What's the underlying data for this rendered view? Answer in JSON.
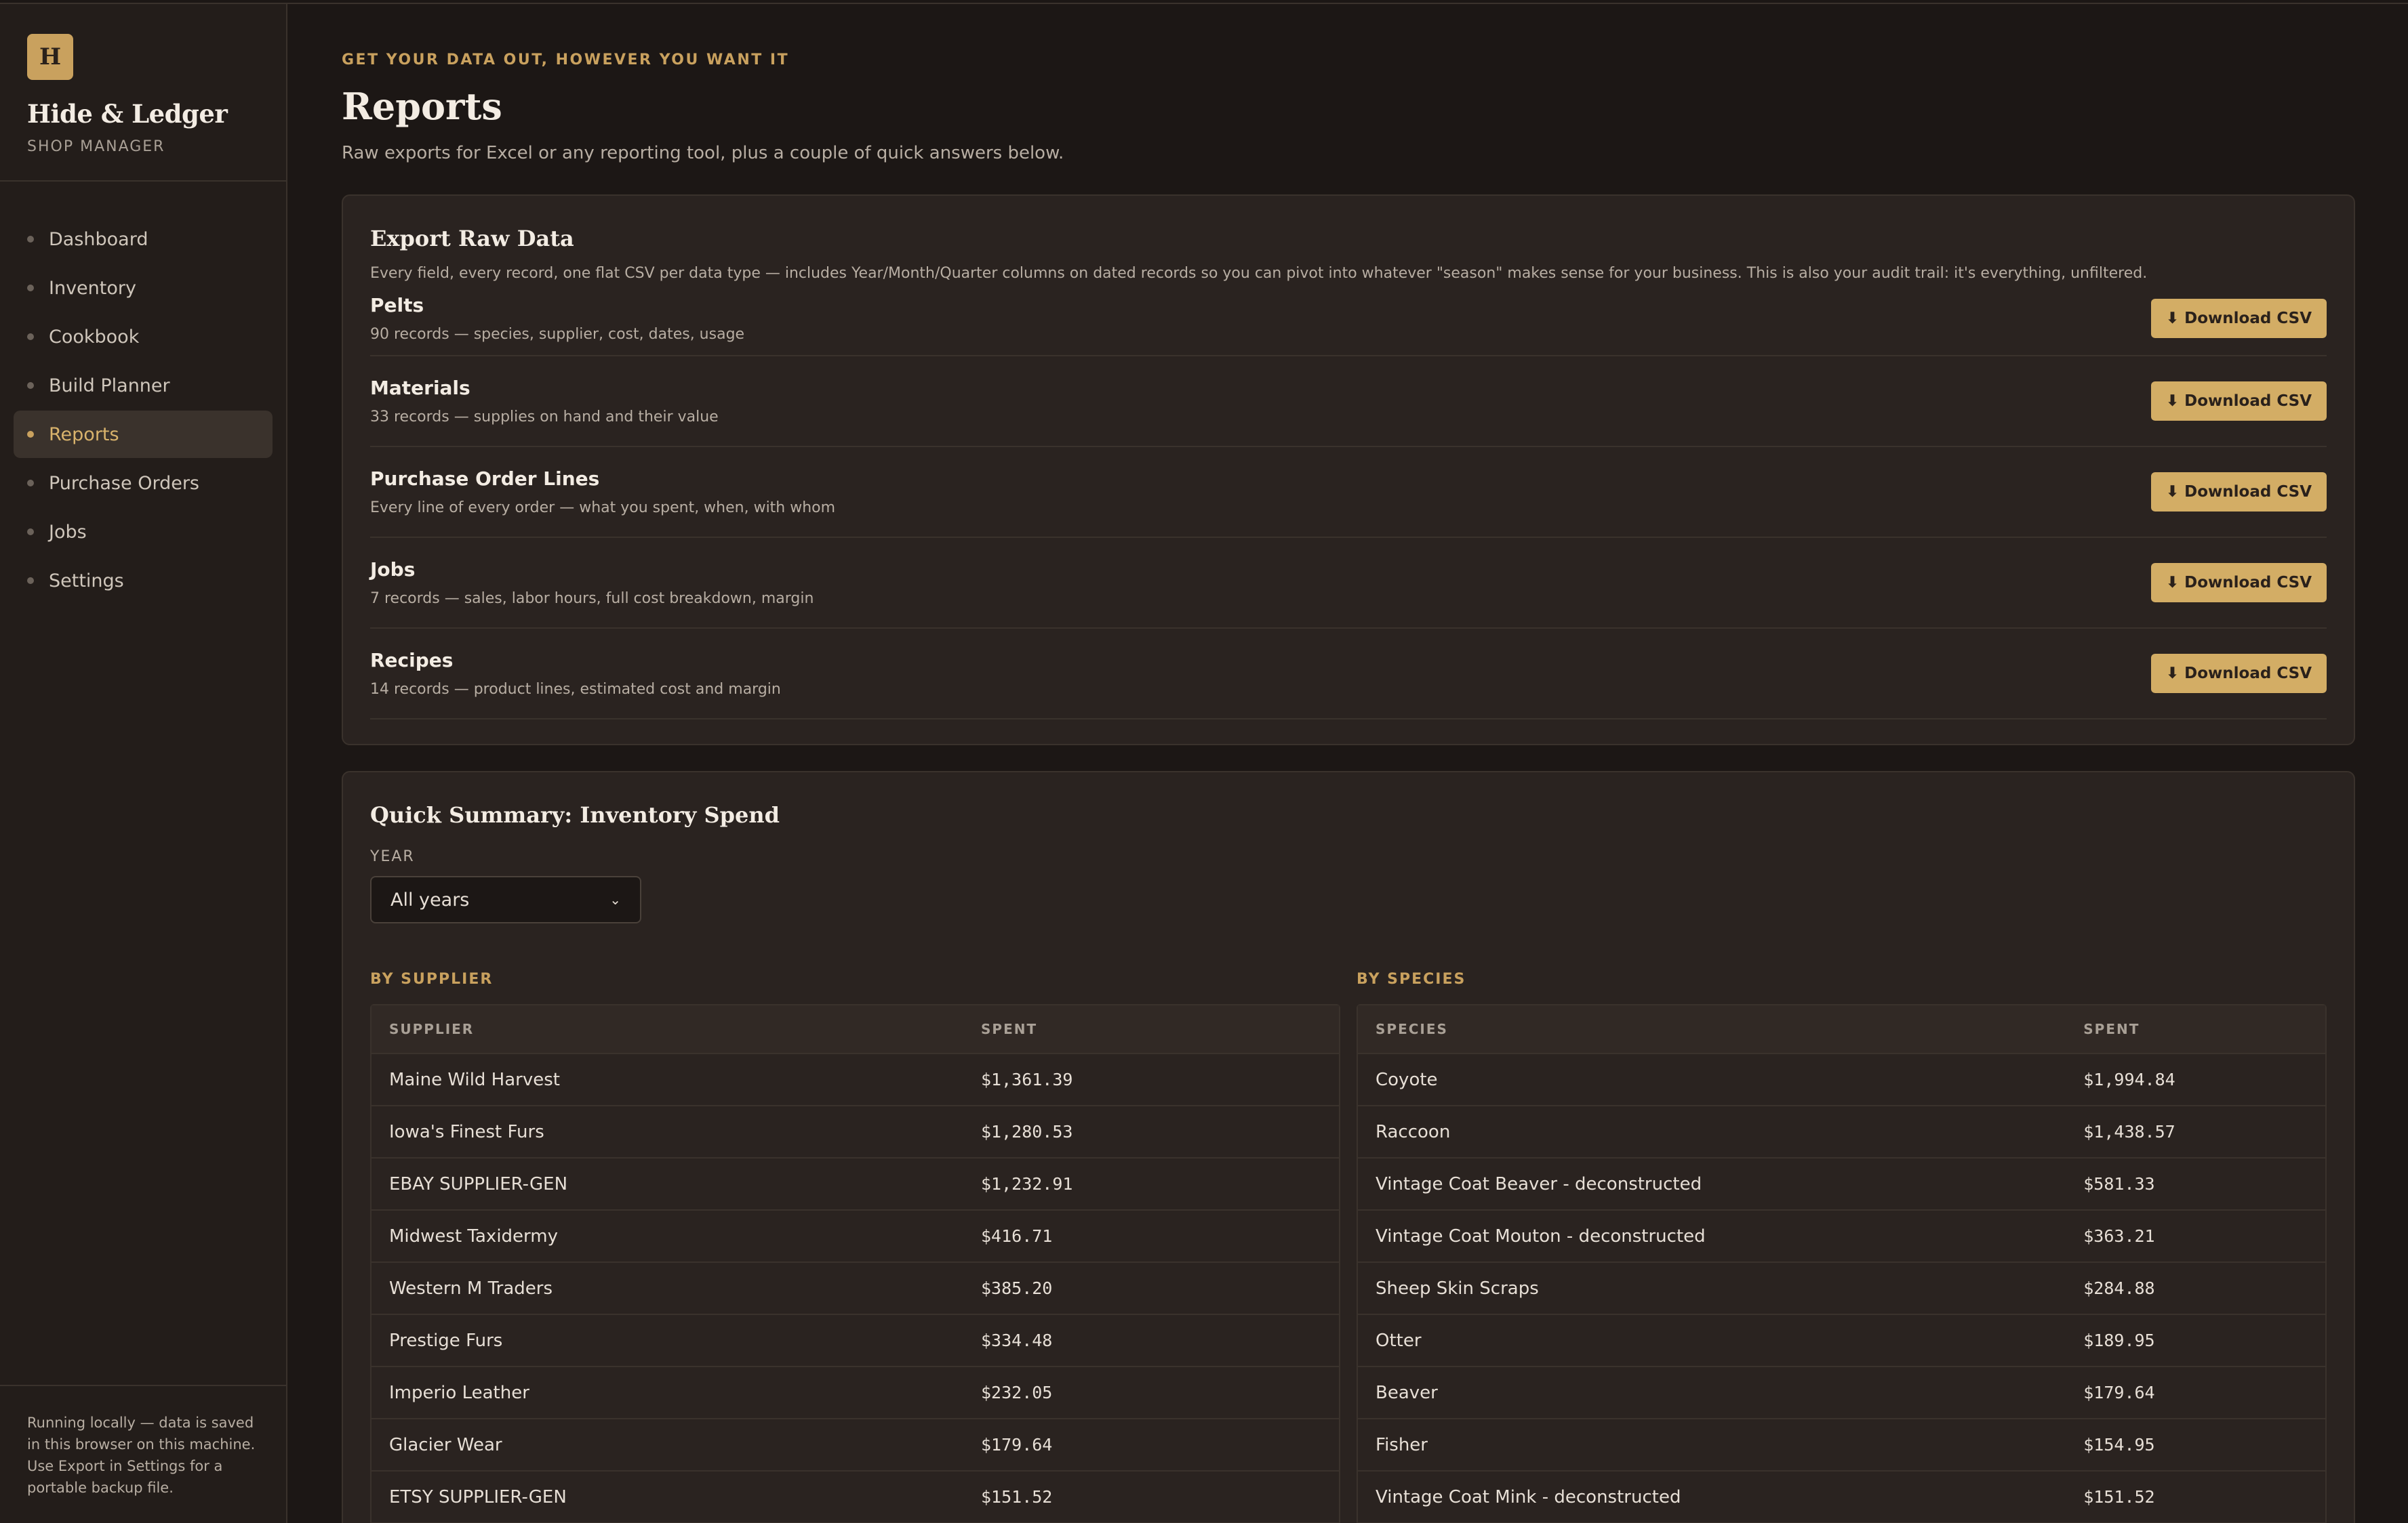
{
  "brand": {
    "logo_letter": "H",
    "name": "Hide & Ledger",
    "subtitle": "SHOP MANAGER"
  },
  "nav": [
    {
      "label": "Dashboard",
      "active": false
    },
    {
      "label": "Inventory",
      "active": false
    },
    {
      "label": "Cookbook",
      "active": false
    },
    {
      "label": "Build Planner",
      "active": false
    },
    {
      "label": "Reports",
      "active": true
    },
    {
      "label": "Purchase Orders",
      "active": false
    },
    {
      "label": "Jobs",
      "active": false
    },
    {
      "label": "Settings",
      "active": false
    }
  ],
  "sidebar_footer": "Running locally — data is saved in this browser on this machine. Use Export in Settings for a portable backup file.",
  "header": {
    "eyebrow": "GET YOUR DATA OUT, HOWEVER YOU WANT IT",
    "title": "Reports",
    "subtitle": "Raw exports for Excel or any reporting tool, plus a couple of quick answers below."
  },
  "export": {
    "title": "Export Raw Data",
    "description": "Every field, every record, one flat CSV per data type — includes Year/Month/Quarter columns on dated records so you can pivot into whatever \"season\" makes sense for your business. This is also your audit trail: it's everything, unfiltered.",
    "button_label": "Download CSV",
    "rows": [
      {
        "title": "Pelts",
        "desc": "90 records — species, supplier, cost, dates, usage"
      },
      {
        "title": "Materials",
        "desc": "33 records — supplies on hand and their value"
      },
      {
        "title": "Purchase Order Lines",
        "desc": "Every line of every order — what you spent, when, with whom"
      },
      {
        "title": "Jobs",
        "desc": "7 records — sales, labor hours, full cost breakdown, margin"
      },
      {
        "title": "Recipes",
        "desc": "14 records — product lines, estimated cost and margin"
      }
    ]
  },
  "summary": {
    "title": "Quick Summary: Inventory Spend",
    "year_label": "YEAR",
    "year_value": "All years",
    "by_supplier": {
      "heading": "BY SUPPLIER",
      "col1": "SUPPLIER",
      "col2": "SPENT",
      "rows": [
        [
          "Maine Wild Harvest",
          "$1,361.39"
        ],
        [
          "Iowa's Finest Furs",
          "$1,280.53"
        ],
        [
          "EBAY SUPPLIER-GEN",
          "$1,232.91"
        ],
        [
          "Midwest Taxidermy",
          "$416.71"
        ],
        [
          "Western M Traders",
          "$385.20"
        ],
        [
          "Prestige Furs",
          "$334.48"
        ],
        [
          "Imperio Leather",
          "$232.05"
        ],
        [
          "Glacier Wear",
          "$179.64"
        ],
        [
          "ETSY SUPPLIER-GEN",
          "$151.52"
        ]
      ]
    },
    "by_species": {
      "heading": "BY SPECIES",
      "col1": "SPECIES",
      "col2": "SPENT",
      "rows": [
        [
          "Coyote",
          "$1,994.84"
        ],
        [
          "Raccoon",
          "$1,438.57"
        ],
        [
          "Vintage Coat Beaver - deconstructed",
          "$581.33"
        ],
        [
          "Vintage Coat Mouton - deconstructed",
          "$363.21"
        ],
        [
          "Sheep Skin Scraps",
          "$284.88"
        ],
        [
          "Otter",
          "$189.95"
        ],
        [
          "Beaver",
          "$179.64"
        ],
        [
          "Fisher",
          "$154.95"
        ],
        [
          "Vintage Coat Mink - deconstructed",
          "$151.52"
        ]
      ]
    }
  }
}
